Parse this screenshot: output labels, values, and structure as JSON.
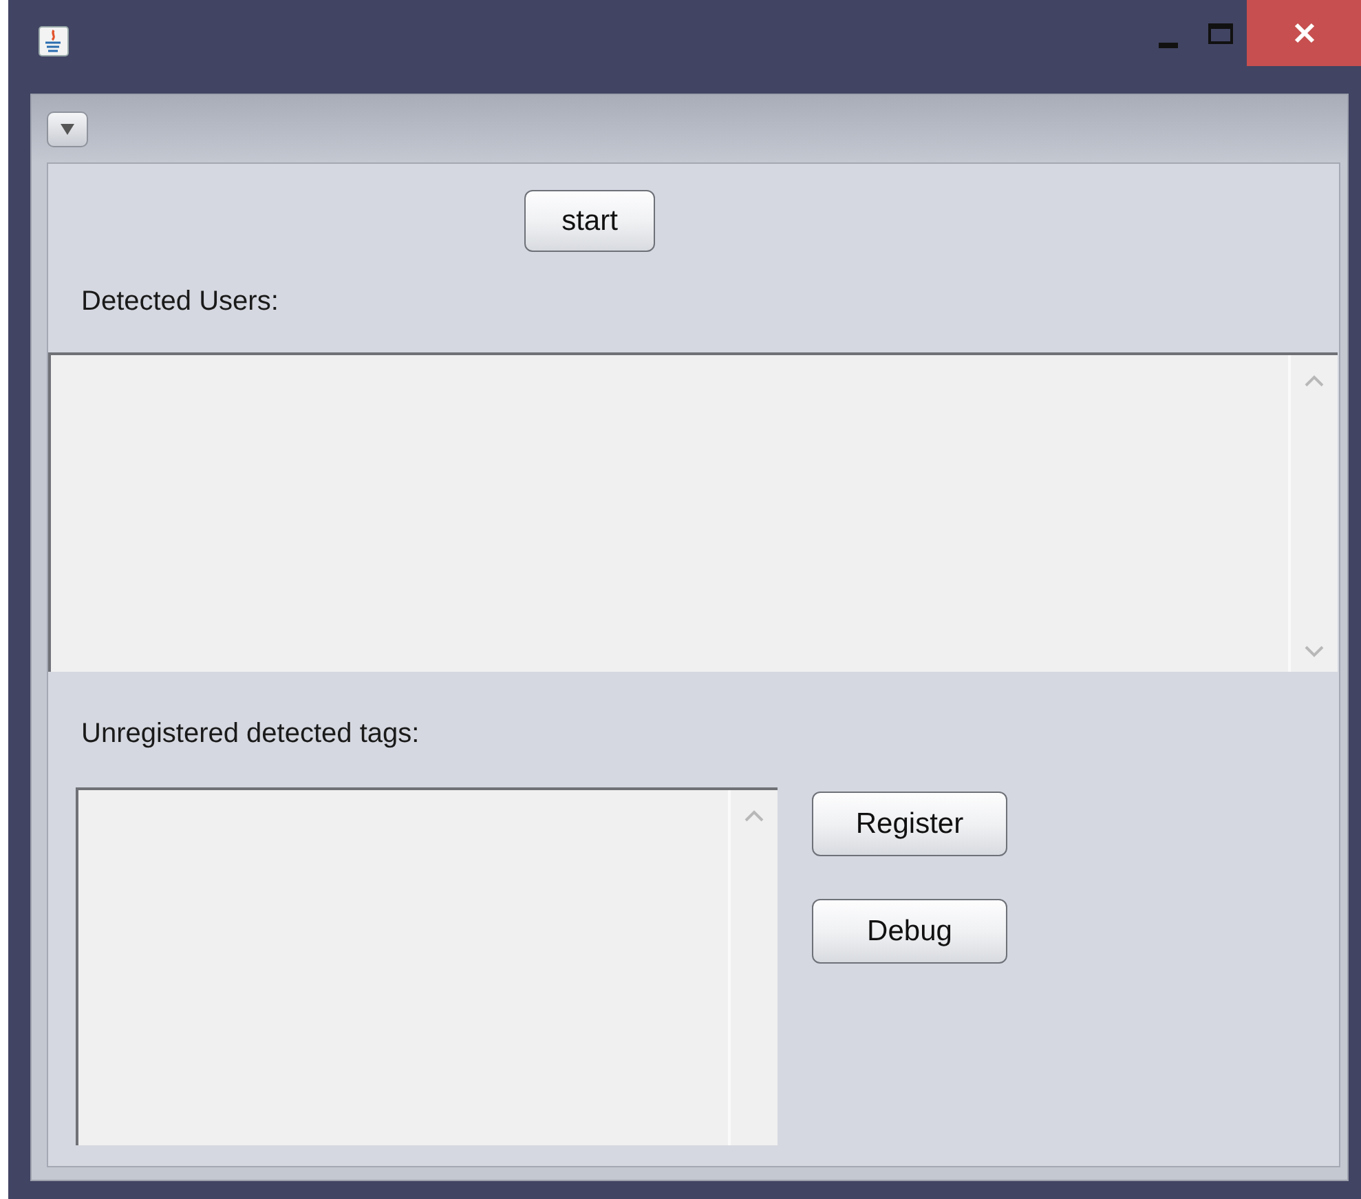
{
  "window": {
    "controls": [
      {
        "kind": "minimize"
      },
      {
        "kind": "maximize"
      },
      {
        "kind": "close"
      }
    ]
  },
  "start_button": {
    "label": "start"
  },
  "detected_users": {
    "label": "Detected Users:"
  },
  "unregistered_tags": {
    "label": "Unregistered detected tags:"
  },
  "actions": [
    {
      "label": "Register"
    },
    {
      "label": "Debug"
    }
  ]
}
